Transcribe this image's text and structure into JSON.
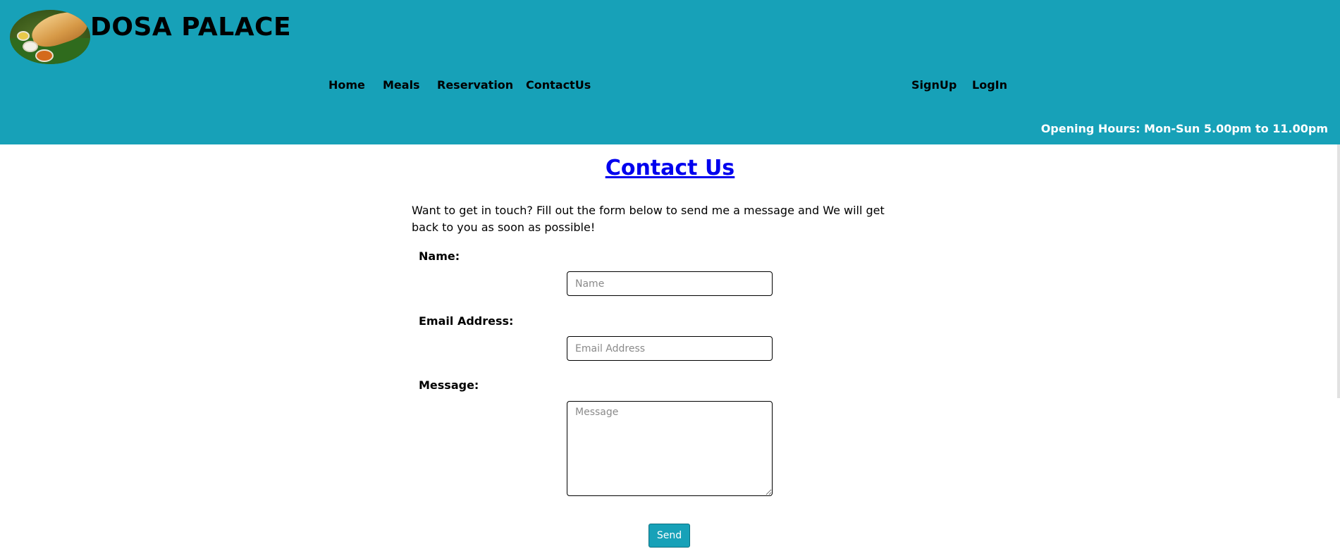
{
  "brand": {
    "name": "DOSA PALACE"
  },
  "nav": {
    "left": [
      "Home",
      "Meals",
      "Reservation",
      "ContactUs"
    ],
    "right": [
      "SignUp",
      "LogIn"
    ]
  },
  "header": {
    "hours": "Opening Hours: Mon-Sun 5.00pm to 11.00pm"
  },
  "contact": {
    "title": "Contact Us",
    "intro": "Want to get in touch? Fill out the form below to send me a message and We will get back to you as soon as possible!",
    "name_label": "Name:",
    "name_placeholder": "Name",
    "email_label": "Email Address:",
    "email_placeholder": "Email Address",
    "message_label": "Message:",
    "message_placeholder": "Message",
    "send_label": "Send"
  },
  "colors": {
    "header_bg": "#17a1b8",
    "link": "#0000ee",
    "button_bg": "#17a1b8"
  },
  "icons": {
    "logo": "dosa-logo-icon"
  }
}
